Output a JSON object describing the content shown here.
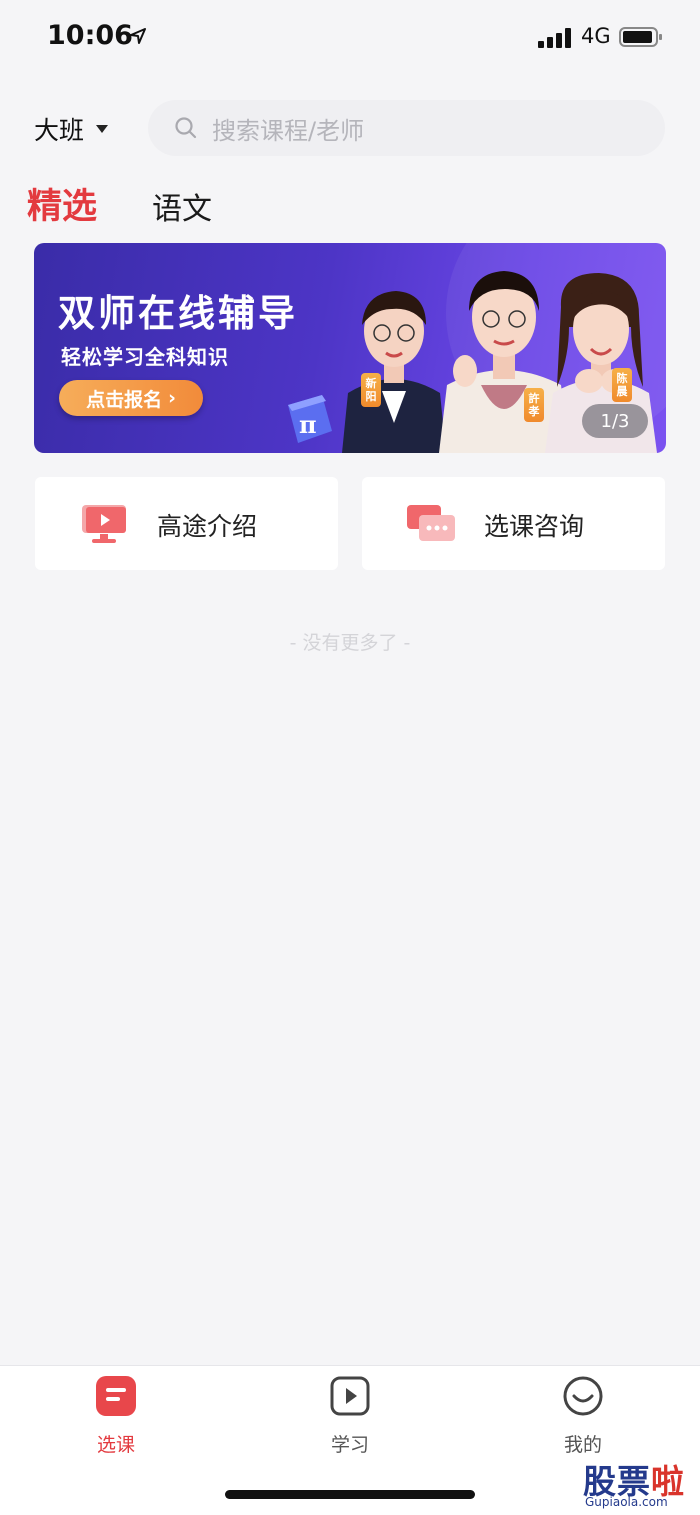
{
  "status_bar": {
    "time": "10:06",
    "network": "4G"
  },
  "header": {
    "class_selector": "大班",
    "search_placeholder": "搜索课程/老师"
  },
  "tabs": [
    {
      "label": "精选",
      "active": true
    },
    {
      "label": "语文",
      "active": false
    }
  ],
  "banner": {
    "title": "双师在线辅导",
    "subtitle": "轻松学习全科知识",
    "cta": "点击报名",
    "cta_arrow": "›",
    "teacher_tags": [
      "新阳",
      "許孝",
      "陈晨"
    ],
    "page_indicator": "1/3"
  },
  "quick_links": [
    {
      "label": "高途介绍",
      "icon": "monitor-play-icon"
    },
    {
      "label": "选课咨询",
      "icon": "chat-bubbles-icon"
    }
  ],
  "list_end_text": "- 没有更多了 -",
  "tab_bar": [
    {
      "label": "选课",
      "icon": "course-icon",
      "active": true
    },
    {
      "label": "学习",
      "icon": "play-icon",
      "active": false
    },
    {
      "label": "我的",
      "icon": "smile-icon",
      "active": false
    }
  ],
  "watermark": {
    "title": "股票啦",
    "url": "Gupiaola.com"
  },
  "colors": {
    "accent": "#e33a3f",
    "banner_start": "#3a2ca8",
    "banner_end": "#7b52f0",
    "cta_orange": "#f28b3a"
  }
}
